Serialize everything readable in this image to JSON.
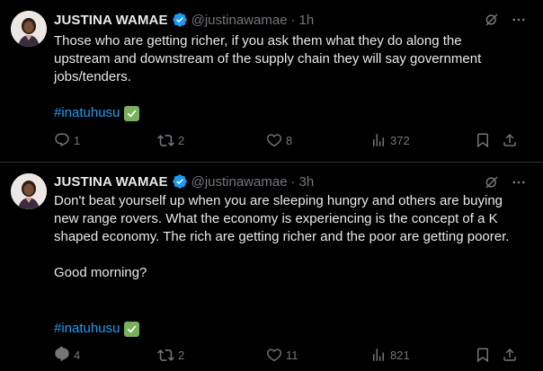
{
  "colors": {
    "accent": "#1d9bf0",
    "text": "#e7e9ea",
    "muted": "#71767b",
    "divider": "#2f3336",
    "check": "#78b159"
  },
  "tweets": [
    {
      "name": "JUSTINA WAMAE",
      "handle": "@justinawamae",
      "dot": "·",
      "time": "1h",
      "paragraphs": [
        "Those who are getting richer, if you ask them what they do along the upstream and downstream of the supply chain they will say government jobs/tenders."
      ],
      "hashtag": "#inatuhusu",
      "replies": "1",
      "reposts": "2",
      "likes": "8",
      "views": "372"
    },
    {
      "name": "JUSTINA WAMAE",
      "handle": "@justinawamae",
      "dot": "·",
      "time": "3h",
      "paragraphs": [
        "Don't beat yourself up when you are sleeping hungry and others are buying new range rovers. What the economy is experiencing is the concept of a K shaped economy. The rich are getting richer and the poor are getting poorer.",
        "Good morning?"
      ],
      "hashtag": "#inatuhusu",
      "replies": "4",
      "reposts": "2",
      "likes": "11",
      "views": "821"
    }
  ]
}
